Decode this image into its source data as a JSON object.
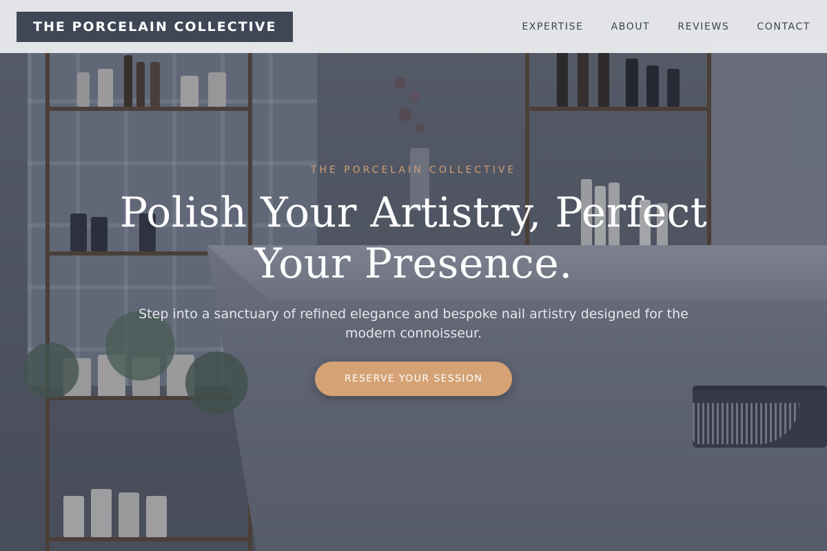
{
  "header": {
    "brand": "THE PORCELAIN COLLECTIVE",
    "nav": [
      {
        "label": "EXPERTISE"
      },
      {
        "label": "ABOUT"
      },
      {
        "label": "REVIEWS"
      },
      {
        "label": "CONTACT"
      }
    ]
  },
  "hero": {
    "eyebrow": "THE PORCELAIN COLLECTIVE",
    "headline": "Polish Your Artistry, Perfect Your Presence.",
    "subtext": "Step into a sanctuary of refined elegance and bespoke nail artistry designed for the modern connoisseur.",
    "cta_label": "RESERVE YOUR SESSION"
  },
  "colors": {
    "brand_bg": "#3f4757",
    "accent": "#d4a274",
    "eyebrow": "#cf9f74",
    "header_bg": "#e9eaec"
  }
}
